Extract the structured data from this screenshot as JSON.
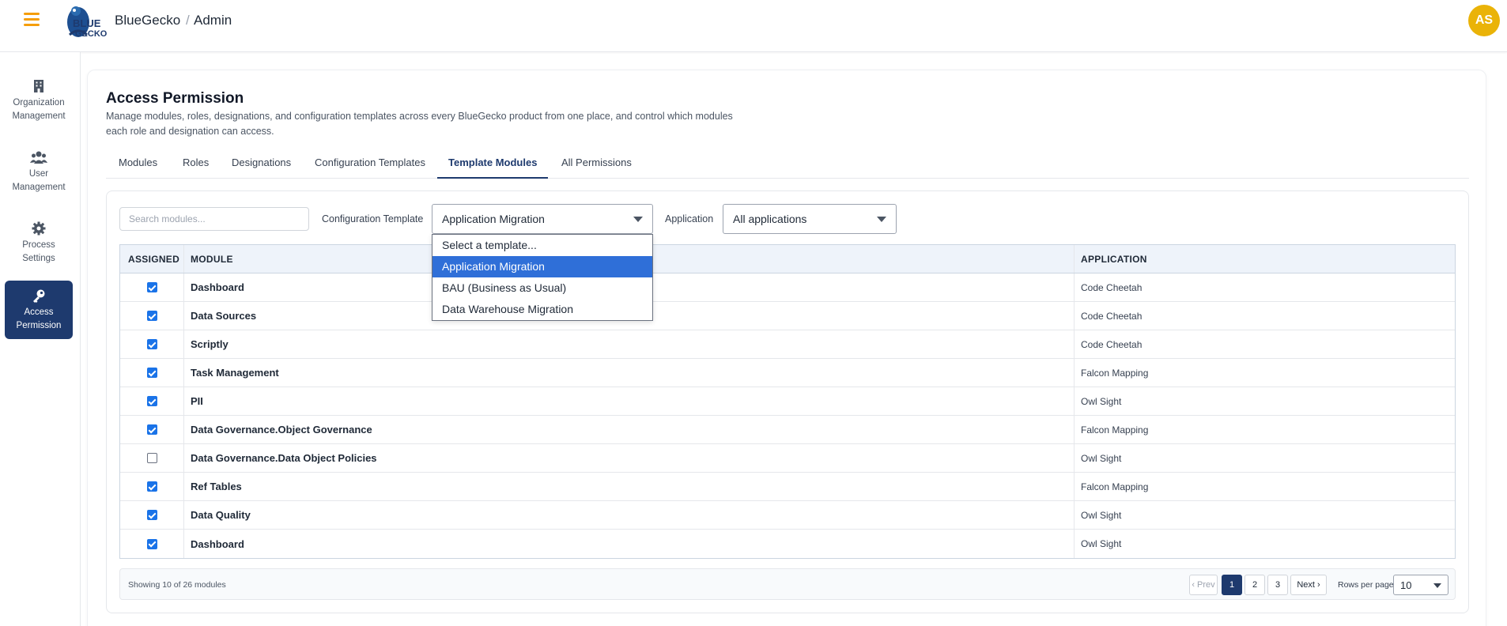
{
  "header": {
    "brand": "BlueGecko",
    "breadcrumb_sep": "/",
    "breadcrumb": "Admin",
    "avatar_initials": "AS",
    "accent_color": "#f59e0b"
  },
  "sidebar": {
    "items": [
      {
        "label": "Organization Management",
        "icon": "building-icon",
        "active": false
      },
      {
        "label": "User Management",
        "icon": "users-icon",
        "active": false
      },
      {
        "label": "Process Settings",
        "icon": "gear-icon",
        "active": false
      },
      {
        "label": "Access Permission",
        "icon": "key-icon",
        "active": true
      }
    ]
  },
  "page": {
    "title": "Access Permission",
    "description": "Manage modules, roles, designations, and configuration templates across every BlueGecko product from one place, and control which modules each role and designation can access."
  },
  "tabs": [
    "Modules",
    "Roles",
    "Designations",
    "Configuration Templates",
    "Template Modules",
    "All Permissions"
  ],
  "active_tab": "Template Modules",
  "filters": {
    "search_placeholder": "Search modules...",
    "template_label": "Configuration Template",
    "template_value": "Application Migration",
    "application_label": "Application",
    "application_value": "All applications"
  },
  "template_dropdown": {
    "options": [
      "Select a template...",
      "Application Migration",
      "BAU (Business as Usual)",
      "Data Warehouse Migration"
    ],
    "selected": "Application Migration"
  },
  "table": {
    "headers": {
      "assigned": "ASSIGNED",
      "module": "MODULE",
      "application": "APPLICATION"
    },
    "rows": [
      {
        "assigned": true,
        "module": "Dashboard",
        "application": "Code Cheetah"
      },
      {
        "assigned": true,
        "module": "Data Sources",
        "application": "Code Cheetah"
      },
      {
        "assigned": true,
        "module": "Scriptly",
        "application": "Code Cheetah"
      },
      {
        "assigned": true,
        "module": "Task Management",
        "application": "Falcon Mapping"
      },
      {
        "assigned": true,
        "module": "PII",
        "application": "Owl Sight"
      },
      {
        "assigned": true,
        "module": "Data Governance.Object Governance",
        "application": "Falcon Mapping"
      },
      {
        "assigned": false,
        "module": "Data Governance.Data Object Policies",
        "application": "Owl Sight"
      },
      {
        "assigned": true,
        "module": "Ref Tables",
        "application": "Falcon Mapping"
      },
      {
        "assigned": true,
        "module": "Data Quality",
        "application": "Owl Sight"
      },
      {
        "assigned": true,
        "module": "Dashboard",
        "application": "Owl Sight"
      }
    ]
  },
  "footer": {
    "showing": "Showing 10 of 26 modules",
    "prev": "‹ Prev",
    "pages": [
      "1",
      "2",
      "3"
    ],
    "current_page": "1",
    "next": "Next ›",
    "rows_per_page_label": "Rows per page",
    "rows_per_page": "10"
  }
}
